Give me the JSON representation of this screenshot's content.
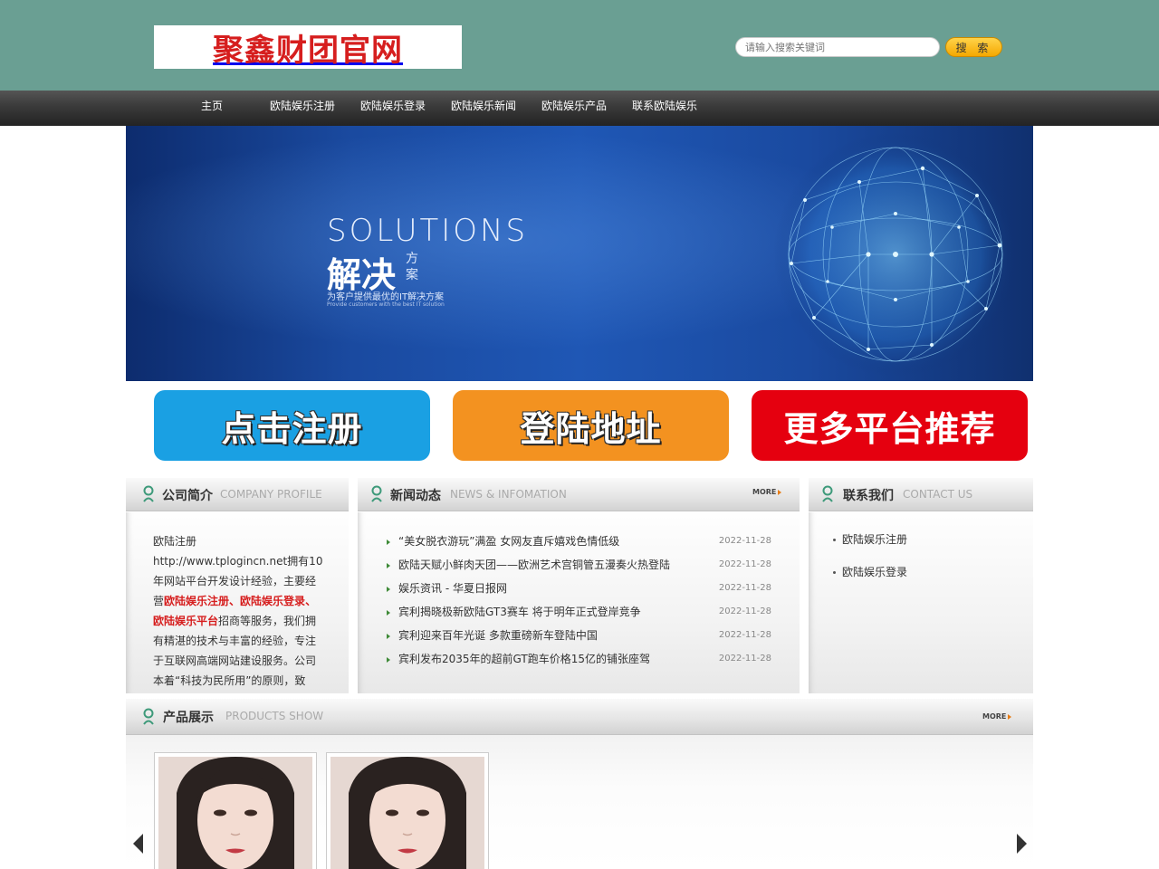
{
  "header": {
    "logo_text": "聚鑫财团官网",
    "search_placeholder": "请输入搜索关键词",
    "search_button": "搜 索"
  },
  "nav": {
    "items": [
      {
        "label": "主页"
      },
      {
        "label": "欧陆娱乐注册"
      },
      {
        "label": "欧陆娱乐登录"
      },
      {
        "label": "欧陆娱乐新闻"
      },
      {
        "label": "欧陆娱乐产品"
      },
      {
        "label": "联系欧陆娱乐"
      }
    ]
  },
  "banner": {
    "title_en": "SOLUTIONS",
    "title_cn": "解决",
    "title_cn_side": "方案",
    "subtitle_cn": "为客户提供最优的IT解决方案",
    "subtitle_en": "Provide customers with the best IT solution"
  },
  "big_buttons": {
    "register": "点击注册",
    "login": "登陆地址",
    "more": "更多平台推荐"
  },
  "profile": {
    "title": "公司简介",
    "title_en": "COMPANY PROFILE",
    "text_1": "欧陆注册http://www.tplogincn.net拥有10年网站平台开发设计经验，主要经营",
    "hl_1": "欧陆娱乐注册",
    "sep_1": "、",
    "hl_2": "欧陆娱乐登录",
    "sep_2": "、",
    "hl_3": "欧陆娱乐平台",
    "text_2": "招商等服务，我们拥有精湛的技术与丰富的经验，专注于互联网高端网站建设服务。公司本着“科技为民所用”的原则，致"
  },
  "news": {
    "title": "新闻动态",
    "title_en": "NEWS & INFOMATION",
    "more": "MORE",
    "items": [
      {
        "title": "“美女脱衣游玩”满盈 女网友直斥嬉戏色情低级",
        "date": "2022-11-28"
      },
      {
        "title": "欧陆天赋小鲜肉天团——欧洲艺术宫铜管五漫奏火热登陆",
        "date": "2022-11-28"
      },
      {
        "title": "娱乐资讯 - 华夏日报网",
        "date": "2022-11-28"
      },
      {
        "title": "宾利揭晓极新欧陆GT3赛车 将于明年正式登岸竞争",
        "date": "2022-11-28"
      },
      {
        "title": "宾利迎来百年光诞 多款重磅新车登陆中国",
        "date": "2022-11-28"
      },
      {
        "title": "宾利发布2035年的超前GT跑车价格15亿的铺张座驾",
        "date": "2022-11-28"
      }
    ]
  },
  "contact": {
    "title": "联系我们",
    "title_en": "CONTACT US",
    "items": [
      {
        "label": "欧陆娱乐注册"
      },
      {
        "label": "欧陆娱乐登录"
      }
    ]
  },
  "products": {
    "title": "产品展示",
    "title_en": "PRODUCTS SHOW",
    "more": "MORE"
  },
  "colors": {
    "header_bg": "#6a9f93",
    "logo_red": "#d61e1e",
    "btn_blue": "#1aa0e3",
    "btn_orange": "#f39220",
    "btn_red": "#e5000f",
    "arrow_green": "#3e8a37"
  }
}
